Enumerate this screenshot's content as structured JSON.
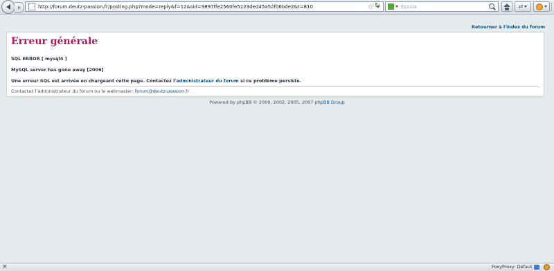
{
  "browser": {
    "url": "http://forum.deutz-passion.fr/posting.php?mode=reply&f=12&sid=9897ffe2560fe5123ded45a52f06bde2&t=810",
    "search_placeholder": "Ecosia"
  },
  "page": {
    "top_link": "Retourner à l'index du forum",
    "error_title": "Erreur générale",
    "sql_error": "SQL ERROR [ mysql4 ]",
    "mysql_message": "MySQL server has gone away [2006]",
    "message_prefix": "Une erreur SQL est arrivée en chargeant cette page. Contactez l'",
    "message_link": "administrateur du forum",
    "message_suffix": " si ce problème persiste.",
    "contact_prefix": "Contactez l'administrateur du forum ou le webmaster: ",
    "contact_email": "forum@deutz-passion.fr",
    "footer_prefix": "Powered by phpBB © 2000, 2002, 2005, 2007 ",
    "footer_link": "phpBB Group"
  },
  "statusbar": {
    "close_glyph": "×",
    "proxy_text": "FoxyProxy: Défaut"
  },
  "icons": {
    "back": "back-arrow-icon",
    "forward": "forward-arrow-icon",
    "page": "page-icon",
    "bookmark": "star-icon",
    "reload": "reload-icon",
    "search_engine": "ecosia-icon",
    "search": "magnifier-icon",
    "home": "home-icon",
    "tools": "tools-icon",
    "addon": "greasemonkey-icon"
  },
  "colors": {
    "title": "#b01a63",
    "link": "#105289",
    "page_bg": "#e5ebed"
  }
}
